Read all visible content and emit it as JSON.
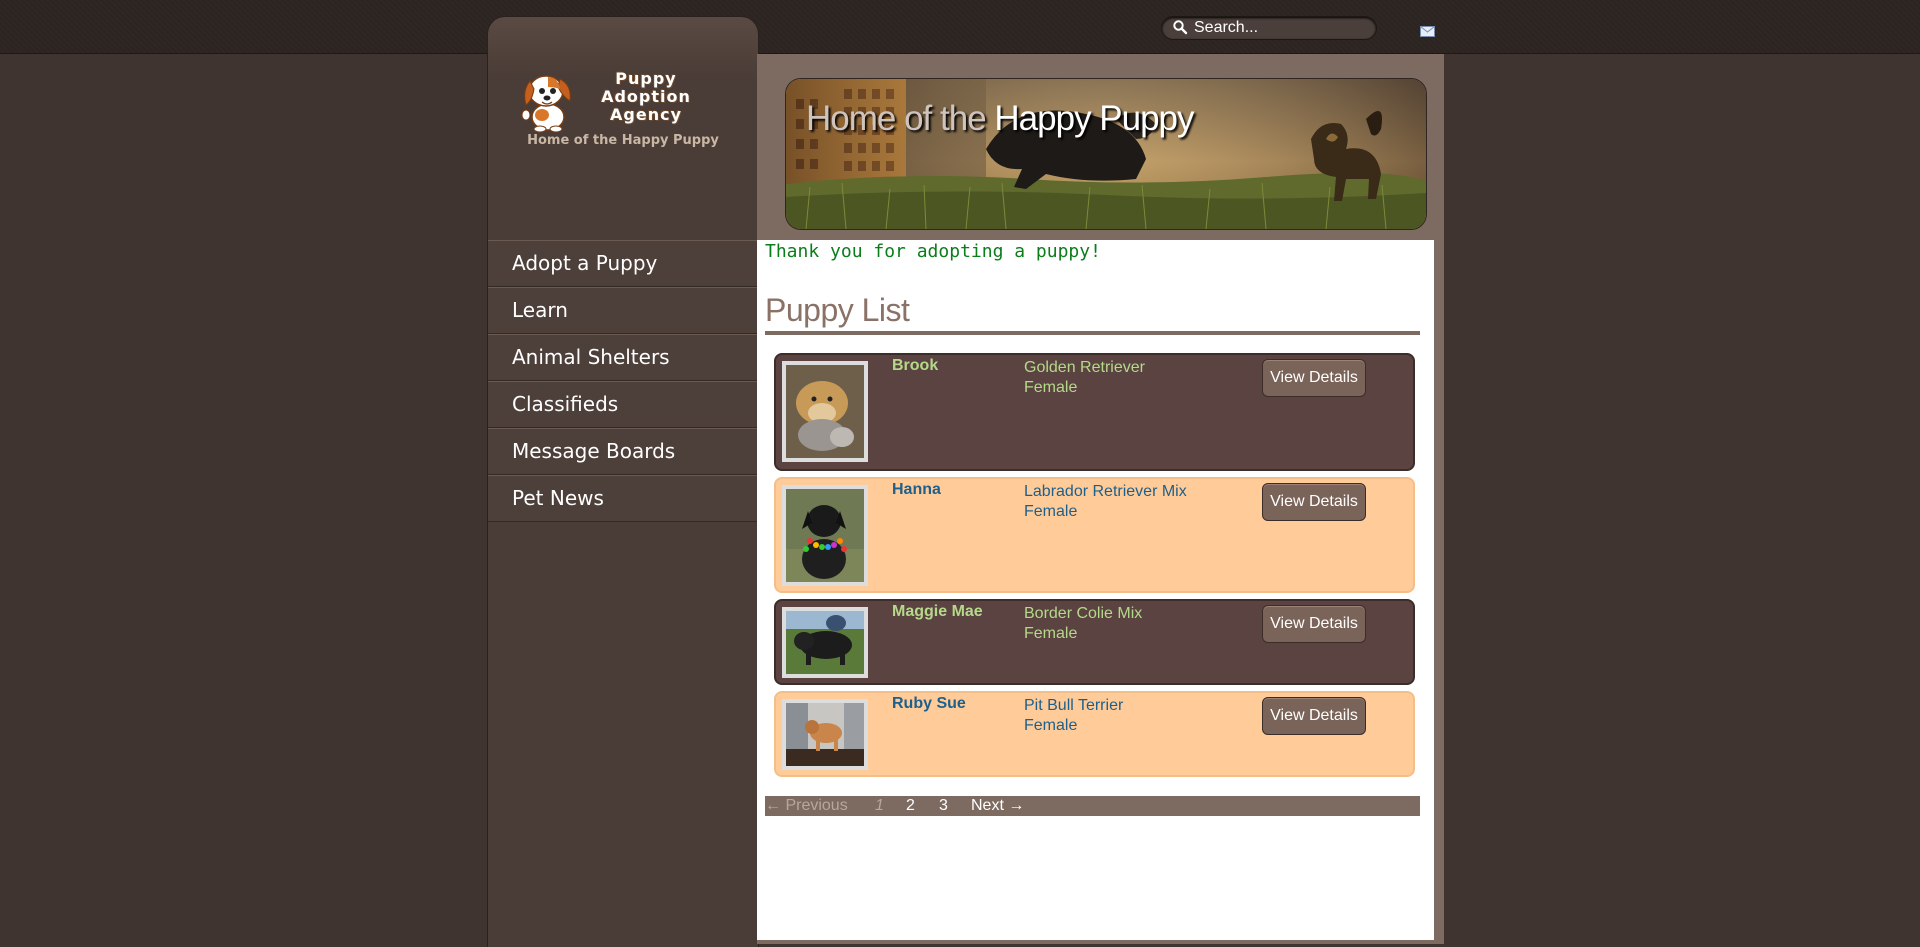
{
  "search": {
    "placeholder": "Search..."
  },
  "header_icons": {
    "search": "search-icon",
    "mail": "mail-icon"
  },
  "logo": {
    "line1": "Puppy",
    "line2": "Adoption",
    "line3": "Agency",
    "tagline": "Home of the Happy Puppy"
  },
  "banner": {
    "title_prefix": "Home of the ",
    "title_emphasis": "Happy Puppy"
  },
  "nav": [
    {
      "label": "Adopt a Puppy"
    },
    {
      "label": "Learn"
    },
    {
      "label": "Animal Shelters"
    },
    {
      "label": "Classifieds"
    },
    {
      "label": "Message Boards"
    },
    {
      "label": "Pet News"
    }
  ],
  "main": {
    "notice": "Thank you for adopting a puppy!",
    "heading": "Puppy List",
    "puppies": [
      {
        "name": "Brook",
        "breed": "Golden Retriever",
        "sex": "Female",
        "button": "View Details"
      },
      {
        "name": "Hanna",
        "breed": "Labrador Retriever Mix",
        "sex": "Female",
        "button": "View Details"
      },
      {
        "name": "Maggie Mae",
        "breed": "Border Colie Mix",
        "sex": "Female",
        "button": "View Details"
      },
      {
        "name": "Ruby Sue",
        "breed": "Pit Bull Terrier",
        "sex": "Female",
        "button": "View Details"
      }
    ],
    "pagination": {
      "previous": "← Previous",
      "pages": [
        "1",
        "2",
        "3"
      ],
      "current": "1",
      "next": "Next →"
    }
  },
  "colors": {
    "page_bg": "#3f3430",
    "sidebar": "#4a3c36",
    "frame": "#7d6a61",
    "card_dark": "#5a4340",
    "card_light": "#ffcc99",
    "text_green": "#b5d98a",
    "text_blue": "#1e5f8b",
    "notice_green": "#0b7d1a"
  }
}
